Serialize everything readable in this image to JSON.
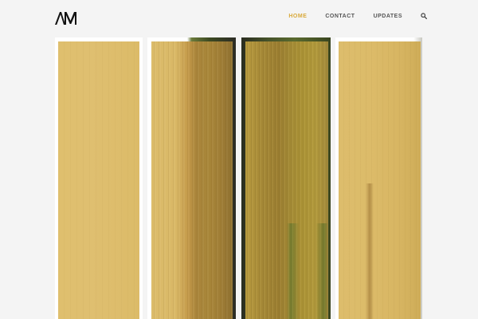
{
  "header": {
    "logo_text": "AM",
    "nav": [
      {
        "label": "HOME",
        "active": true
      },
      {
        "label": "CONTACT",
        "active": false
      },
      {
        "label": "UPDATES",
        "active": false
      }
    ],
    "search_icon": "search-icon"
  },
  "colors": {
    "accent": "#d9a93b",
    "background": "#f4f4f4",
    "panel_gold": "#dfbf6e"
  },
  "gallery": {
    "panels": [
      {
        "name": "gallery-panel-1"
      },
      {
        "name": "gallery-panel-2"
      },
      {
        "name": "gallery-panel-3"
      },
      {
        "name": "gallery-panel-4"
      }
    ]
  }
}
